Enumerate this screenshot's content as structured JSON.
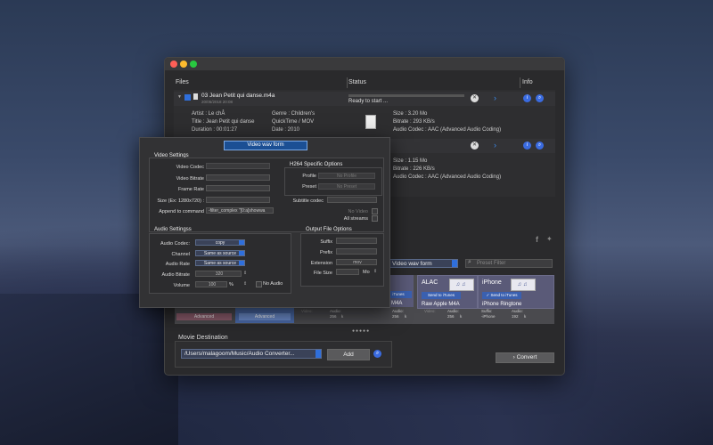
{
  "files_header": {
    "files": "Files",
    "status": "Status",
    "info": "Info"
  },
  "file1": {
    "name": "03 Jean Petit qui danse.m4a",
    "date": "20/05/2018 20:08",
    "status": "Ready to start ...",
    "artist": "Artist : Le chÂ",
    "title": "Title : Jean Petit qui danse",
    "duration": "Duration : 00:01:27",
    "genre": "Genre : Children's",
    "type": "QuickTime / MOV",
    "date_line": "Date : 2010",
    "size": "Size : 3.20 Mo",
    "bitrate": "Bitrate : 293 KB/s",
    "audio_codec": "Audio Codec : AAC (Advanced Audio Coding)"
  },
  "file2": {
    "size": "Size : 1.15 Mo",
    "bitrate": "Bitrate : 226 KB/s",
    "audio_codec": "Audio Codec : AAC (Advanced Audio Coding)"
  },
  "dialog": {
    "title": "Video wav form",
    "video_settings": "Video Settings",
    "video_codec": "Video Codec",
    "video_bitrate": "Video Bitrate",
    "frame_rate": "Frame Rate",
    "size": "Size (Ex: 1280x720) :",
    "append": "Append to command",
    "append_value": "-filter_complex \"[0:a]showwa",
    "h264": "H264 Specific Options",
    "profile": "Profile",
    "profile_value": "No Profile",
    "preset": "Preset",
    "preset_value": "No Preset",
    "subtitle_codec": "Subtitle codec",
    "no_video": "No Video",
    "all_streams": "All streams",
    "audio_settings": "Audio Settingss",
    "audio_codec": "Audio Codec:",
    "audio_codec_value": "copy",
    "channel": "Channel",
    "channel_value": "Same as source",
    "audio_rate": "Audio Rate",
    "audio_rate_value": "Same as source",
    "audio_bitrate": "Audio Bitrate",
    "audio_bitrate_value": "320",
    "volume": "Volume",
    "volume_value": "100",
    "volume_unit": "%",
    "no_audio": "No Audio",
    "output_options": "Output File Options",
    "suffix": "Suffix",
    "prefix": "Prefix",
    "extension": "Extension",
    "extension_value": "mov",
    "file_size": "File Size",
    "file_size_unit": "Mo"
  },
  "toolbar": {
    "preset_select": "Video wav form",
    "preset_filter_placeholder": "Preset Filter"
  },
  "presets": [
    {
      "title": "ALAC",
      "button": "Send to iTunes",
      "label": "Raw Apple M4A"
    },
    {
      "title": "iPhone",
      "button": "✓ Send to iTunes",
      "label": "iPhone Ringtone"
    }
  ],
  "preset_partial_label": "e M4A",
  "preset_partial_button": "iTunes",
  "advanced_labels": [
    "Advanced",
    "Advanced"
  ],
  "preset_stats": {
    "video": "Video:",
    "audio": "Audio:",
    "suffix": "Suffix:",
    "audio_val1": "256",
    "audio_val2": "256",
    "audio_val3": "256",
    "suffix_val": "-iPhone",
    "audio_val4": "192",
    "k": "k"
  },
  "destination": {
    "label": "Movie Destination",
    "path": "/Users/malagoom/Music/Audio Converter...",
    "add": "Add",
    "convert": "Convert"
  },
  "colors": {
    "accent": "#2f6fdc",
    "traffic_red": "#ff5f57",
    "traffic_yellow": "#febc2e",
    "traffic_green": "#28c840"
  }
}
